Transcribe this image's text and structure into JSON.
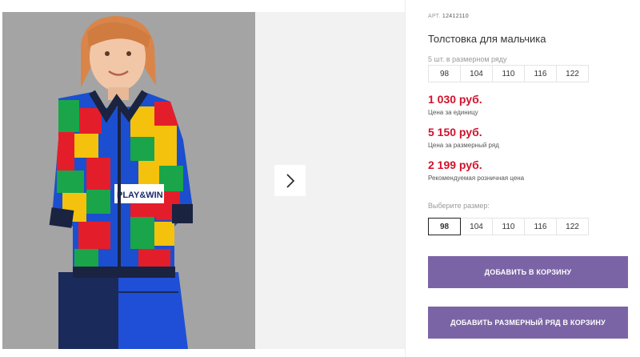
{
  "product": {
    "article_label": "АРТ.",
    "article_value": "12412110",
    "title": "Толстовка для мальчика",
    "pack_label": "5 шт. в размерном ряду",
    "pack_sizes": [
      "98",
      "104",
      "110",
      "116",
      "122"
    ],
    "prices": [
      {
        "value": "1 030 руб.",
        "note": "Цена за единицу"
      },
      {
        "value": "5 150 руб.",
        "note": "Цена за размерный ряд"
      },
      {
        "value": "2 199 руб.",
        "note": "Рекомендуемая розничная цена"
      }
    ],
    "choose_size_label": "Выберите размер:",
    "size_options": [
      "98",
      "104",
      "110",
      "116",
      "122"
    ],
    "selected_size": "98",
    "photo_print_text": "PLAY&WIN"
  },
  "buttons": {
    "add_to_cart": "ДОБАВИТЬ В КОРЗИНУ",
    "add_pack_to_cart": "ДОБАВИТЬ РАЗМЕРНЫЙ РЯД В КОРЗИНУ"
  },
  "gallery": {
    "next_icon": "chevron-right-icon"
  },
  "colors": {
    "price": "#d2112b",
    "button": "#7b64a5",
    "photo_bg": "#a4a4a4"
  }
}
